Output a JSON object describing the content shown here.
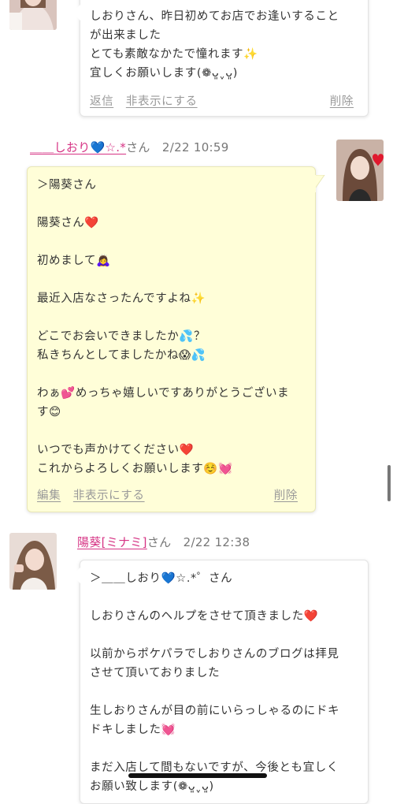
{
  "colors": {
    "accent": "#d63384",
    "muted": "#999999",
    "bubble_yellow": "#fffed8",
    "bubble_white": "#ffffff"
  },
  "comments": [
    {
      "lines": [
        "しおりさん、昨日初めてお店でお逢いすること",
        "が出来ました",
        "とても素敵なかたで憧れます✨",
        "宜しくお願いします(❁ᴗ͈ˬᴗ͈)"
      ],
      "actions": {
        "reply": "返信",
        "hide": "非表示にする",
        "delete": "削除"
      }
    },
    {
      "user": "＿＿しおり💙☆.*",
      "suffix": "さん",
      "time": "2/22 10:59",
      "lines": [
        "＞陽葵さん",
        "",
        "陽葵さん❤️",
        "",
        "初めまして🙇‍♀️",
        "",
        "最近入店なさったんですよね✨",
        "",
        "どこでお会いできましたか💦？",
        "私きちんとしてましたかね😱💦",
        "",
        "わぁ💕めっちゃ嬉しいですありがとうございま",
        "す😊",
        "",
        "いつでも声かけてください❤️",
        "これからよろしくお願いします☺️💓"
      ],
      "actions": {
        "edit": "編集",
        "hide": "非表示にする",
        "delete": "削除"
      }
    },
    {
      "user": "陽葵[ミナミ]",
      "suffix": "さん",
      "time": "2/22 12:38",
      "lines": [
        "＞＿＿しおり💙☆.*゜さん",
        "",
        "しおりさんのヘルプをさせて頂きました❤️",
        "",
        "以前からポケパラでしおりさんのブログは拝見",
        "させて頂いておりました",
        "",
        "生しおりさんが目の前にいらっしゃるのにドキ",
        "ドキしました💓",
        "",
        "まだ入店して間もないですが、今後とも宜しく",
        "お願い致します(❁ᴗ͈ˬᴗ͈)"
      ]
    }
  ]
}
